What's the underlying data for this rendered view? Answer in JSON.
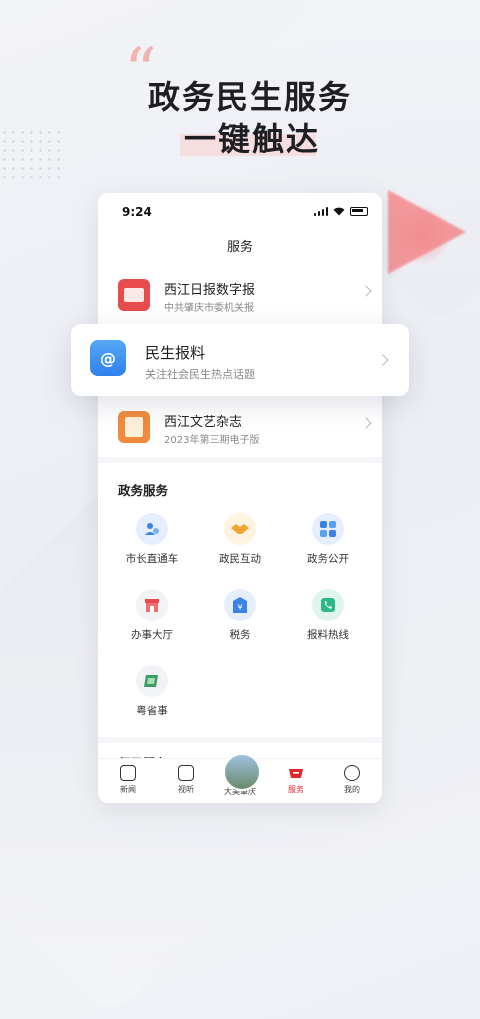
{
  "hero": {
    "quote_mark": "“",
    "line1": "政务民生服务",
    "line2": "一键触达"
  },
  "status": {
    "time": "9:24"
  },
  "page_title": "服务",
  "featured": [
    {
      "title": "西江日报数字报",
      "subtitle": "中共肇庆市委机关报",
      "icon": "newspaper-icon"
    },
    {
      "title": "西江文艺杂志",
      "subtitle": "2023年第三期电子版",
      "icon": "magazine-icon"
    }
  ],
  "floating_card": {
    "title": "民生报料",
    "subtitle": "关注社会民生热点话题",
    "icon_text": "@"
  },
  "gov_section": {
    "title": "政务服务",
    "items": [
      {
        "label": "市长直通车",
        "icon": "mayor-hotline-icon"
      },
      {
        "label": "政民互动",
        "icon": "handshake-icon"
      },
      {
        "label": "政务公开",
        "icon": "gov-open-icon"
      },
      {
        "label": "办事大厅",
        "icon": "service-hall-icon"
      },
      {
        "label": "税务",
        "icon": "tax-icon"
      },
      {
        "label": "报料热线",
        "icon": "phone-icon"
      },
      {
        "label": "粤省事",
        "icon": "yueshengshi-icon"
      }
    ]
  },
  "convenience_section": {
    "title": "便民服务"
  },
  "tabbar": [
    {
      "label": "新闻",
      "icon": "news-icon"
    },
    {
      "label": "视听",
      "icon": "video-icon"
    },
    {
      "label": "大美肇庆",
      "icon": "city-photo-icon"
    },
    {
      "label": "服务",
      "icon": "service-icon",
      "active": true
    },
    {
      "label": "我的",
      "icon": "profile-icon"
    }
  ],
  "colors": {
    "accent": "#e0262b",
    "card_icon_blue": "#2f80ea"
  }
}
